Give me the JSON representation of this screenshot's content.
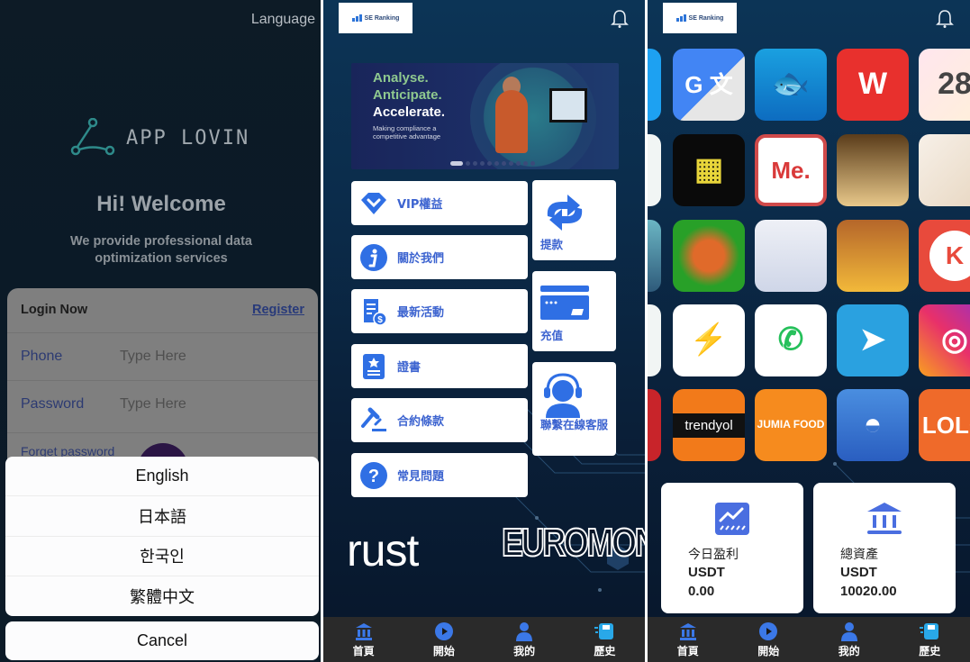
{
  "login_screen": {
    "language_link": "Language",
    "logo_text": "APP LOVIN",
    "welcome_title": "Hi! Welcome",
    "welcome_subtitle_line1": "We provide professional data",
    "welcome_subtitle_line2": "optimization services",
    "login_card": {
      "title": "Login Now",
      "register_link": "Register",
      "phone_label": "Phone",
      "phone_placeholder": "Type Here",
      "phone_value": "",
      "password_label": "Password",
      "password_placeholder": "Type Here",
      "password_value": "",
      "forget_password": "Forget password"
    },
    "language_sheet": {
      "options": [
        "English",
        "日本語",
        "한국인",
        "繁體中文"
      ],
      "cancel_label": "Cancel"
    }
  },
  "home_screen": {
    "brand": "SE Ranking",
    "banner": {
      "line1": "Analyse.",
      "line2": "Anticipate.",
      "line3": "Accelerate.",
      "tagline": "Making compliance a competitive advantage",
      "slide_count": 11,
      "active_slide": 1
    },
    "menu_items": [
      {
        "label": "VIP權益",
        "icon": "diamond-icon"
      },
      {
        "label": "關於我們",
        "icon": "info-icon"
      },
      {
        "label": "最新活動",
        "icon": "receipt-dollar-icon"
      },
      {
        "label": "證書",
        "icon": "certificate-icon"
      },
      {
        "label": "合約條款",
        "icon": "gavel-icon"
      },
      {
        "label": "常見問題",
        "icon": "question-icon"
      }
    ],
    "side_cards": [
      {
        "label": "提款",
        "icon": "swap-arrows-icon"
      },
      {
        "label": "充值",
        "icon": "credit-card-icon"
      },
      {
        "label": "聯繫在線客服",
        "icon": "headset-support-icon"
      }
    ],
    "partners": [
      "rust",
      "EUROMON"
    ]
  },
  "apps_screen": {
    "brand": "SE Ranking",
    "apps": [
      [
        "Twitter",
        "Google Translate",
        "Fishdom",
        "WPS Office",
        "Widgets"
      ],
      [
        "Unknown",
        "Block Puzzle",
        "Me.",
        "Anime Girl",
        "Worms"
      ],
      [
        "Unknown Hero",
        "Carrot Game",
        "Genshin Impact",
        "Clash of Clans",
        "KineMaster"
      ],
      [
        "Unknown",
        "Messenger",
        "WhatsApp",
        "Telegram",
        "Instagram"
      ],
      [
        "Unknown Red",
        "trendyol",
        "Jumia Food",
        "Pokemon GO",
        "LOLO"
      ]
    ],
    "stats": [
      {
        "label": "今日盈利",
        "currency": "USDT",
        "value": "0.00",
        "icon": "trend-chart-icon"
      },
      {
        "label": "總資產",
        "currency": "USDT",
        "value": "10020.00",
        "icon": "bank-icon"
      }
    ]
  },
  "tabbar": [
    {
      "label": "首頁",
      "icon": "bank-icon"
    },
    {
      "label": "開始",
      "icon": "play-icon"
    },
    {
      "label": "我的",
      "icon": "user-icon"
    },
    {
      "label": "歷史",
      "icon": "history-save-icon"
    }
  ],
  "colors": {
    "accent_blue": "#3d64d0",
    "tabbar_bg": "#2a2a2a",
    "login_bg": "#0c1b28",
    "home_bg": "#0b2c4b"
  }
}
